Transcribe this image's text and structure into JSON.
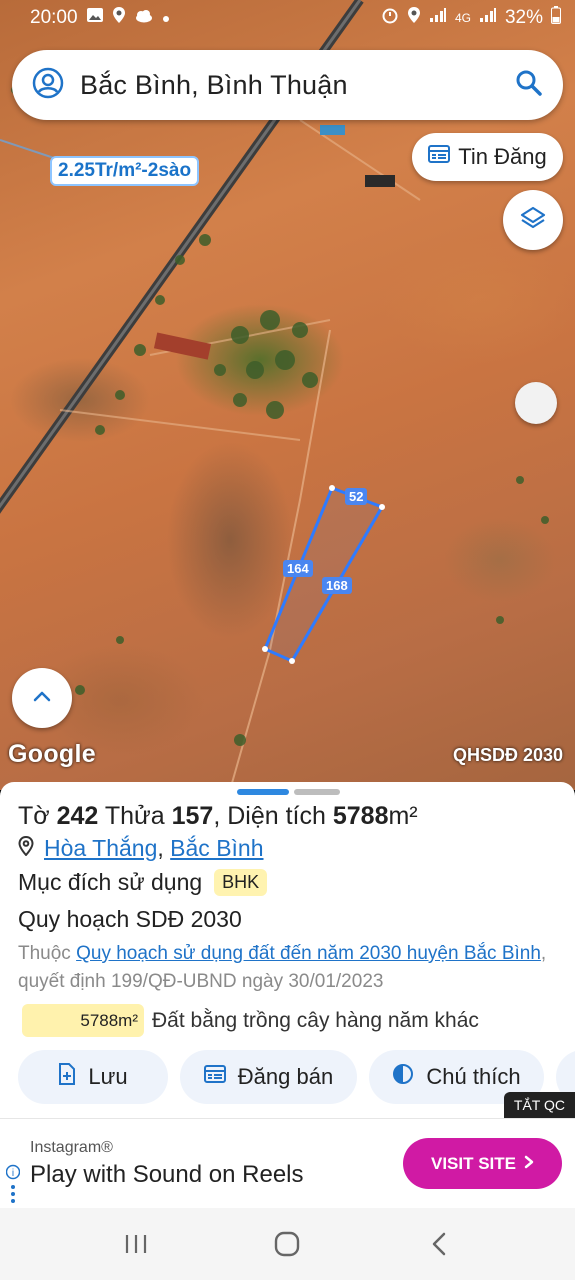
{
  "status_bar": {
    "time": "20:00",
    "network": "4G",
    "battery": "32%"
  },
  "search": {
    "text": "Bắc Bình, Bình Thuận"
  },
  "map": {
    "price_label": "2.25Tr/m²-2sào",
    "tin_dang_label": "Tin Đăng",
    "edge_labels": [
      "52",
      "164",
      "168"
    ],
    "google_label": "Google",
    "map_tag": "QHSDĐ 2030"
  },
  "parcel": {
    "to_label": "Tờ",
    "to_value": "242",
    "thua_label": "Thửa",
    "thua_value": "157",
    "dien_tich_label": ", Diện tích",
    "dien_tich_value": "5788",
    "unit": "m²",
    "location_part1": "Hòa Thắng",
    "location_sep": ", ",
    "location_part2": "Bắc Bình",
    "purpose_label": "Mục đích sử dụng",
    "purpose_badge": "BHK",
    "plan_title": "Quy hoạch SDĐ 2030",
    "desc_prefix": "Thuộc ",
    "desc_link": "Quy hoạch sử dụng đất đến năm 2030 huyện Bắc Bình",
    "desc_suffix": ", quyết định 199/QĐ-UBND ngày 30/01/2023",
    "area_chip": "5788m²",
    "area_desc": "Đất bằng trồng cây hàng năm khác"
  },
  "actions": {
    "save": "Lưu",
    "post_sale": "Đăng bán",
    "legend": "Chú thích"
  },
  "ad": {
    "close_label": "TẮT QC",
    "brand": "Instagram®",
    "headline": "Play with Sound on Reels",
    "cta": "VISIT SITE"
  },
  "colors": {
    "accent": "#1f73c8",
    "badge_bg": "#fff3b0",
    "cta_bg": "#d01aa4",
    "parcel_outline": "#2e7bff"
  }
}
